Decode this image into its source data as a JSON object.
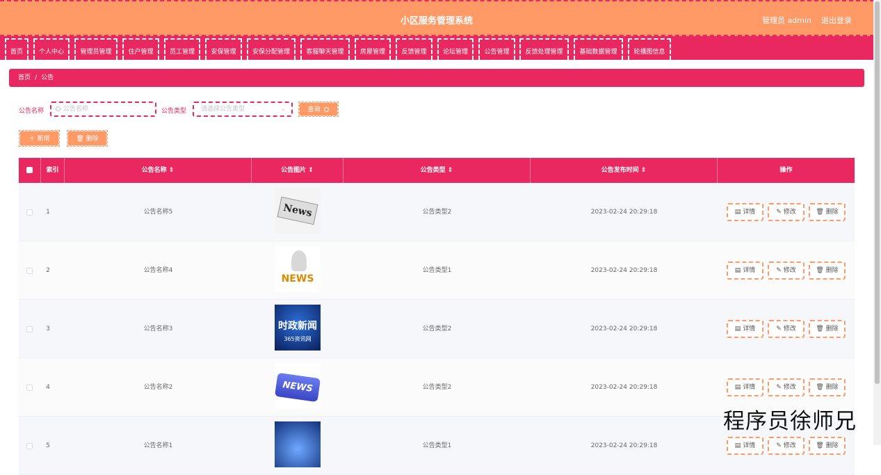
{
  "header": {
    "title": "小区服务管理系统",
    "admin_label": "管理员 admin",
    "logout_label": "退出登录"
  },
  "nav": [
    {
      "label": "首页"
    },
    {
      "label": "个人中心"
    },
    {
      "label": "管理员管理"
    },
    {
      "label": "住户管理"
    },
    {
      "label": "员工管理"
    },
    {
      "label": "安保管理"
    },
    {
      "label": "安保分配管理"
    },
    {
      "label": "客服聊天管理"
    },
    {
      "label": "房屋管理"
    },
    {
      "label": "反馈管理"
    },
    {
      "label": "论坛管理"
    },
    {
      "label": "公告管理"
    },
    {
      "label": "反馈处理管理"
    },
    {
      "label": "基础数据管理"
    },
    {
      "label": "轮播图信息"
    }
  ],
  "breadcrumb": {
    "home": "首页",
    "sep": "/",
    "current": "公告"
  },
  "search": {
    "name_label": "公告名称",
    "name_placeholder": "公告名称",
    "type_label": "公告类型",
    "type_placeholder": "请选择公告类型",
    "query_label": "查询"
  },
  "actions": {
    "add_label": "新增",
    "delete_label": "删除"
  },
  "table": {
    "headers": {
      "index": "索引",
      "name": "公告名称",
      "image": "公告图片",
      "type": "公告类型",
      "time": "公告发布时间",
      "ops": "操作"
    },
    "op_labels": {
      "detail": "详情",
      "edit": "修改",
      "delete": "删除"
    },
    "rows": [
      {
        "index": "1",
        "name": "公告名称5",
        "type": "公告类型2",
        "time": "2023-02-24 20:29:18",
        "thumb_text": "News"
      },
      {
        "index": "2",
        "name": "公告名称4",
        "type": "公告类型1",
        "time": "2023-02-24 20:29:18",
        "thumb_text": "NEWS"
      },
      {
        "index": "3",
        "name": "公告名称3",
        "type": "公告类型2",
        "time": "2023-02-24 20:29:18",
        "thumb_text": "时政新闻",
        "thumb_sub": "365资讯网"
      },
      {
        "index": "4",
        "name": "公告名称2",
        "type": "公告类型2",
        "time": "2023-02-24 20:29:18",
        "thumb_text": "NEWS"
      },
      {
        "index": "5",
        "name": "公告名称1",
        "type": "公告类型1",
        "time": "2023-02-24 20:29:18",
        "thumb_text": ""
      }
    ]
  },
  "watermark": "程序员徐师兄",
  "colors": {
    "primary": "#e9285f",
    "accent": "#ff9966"
  }
}
